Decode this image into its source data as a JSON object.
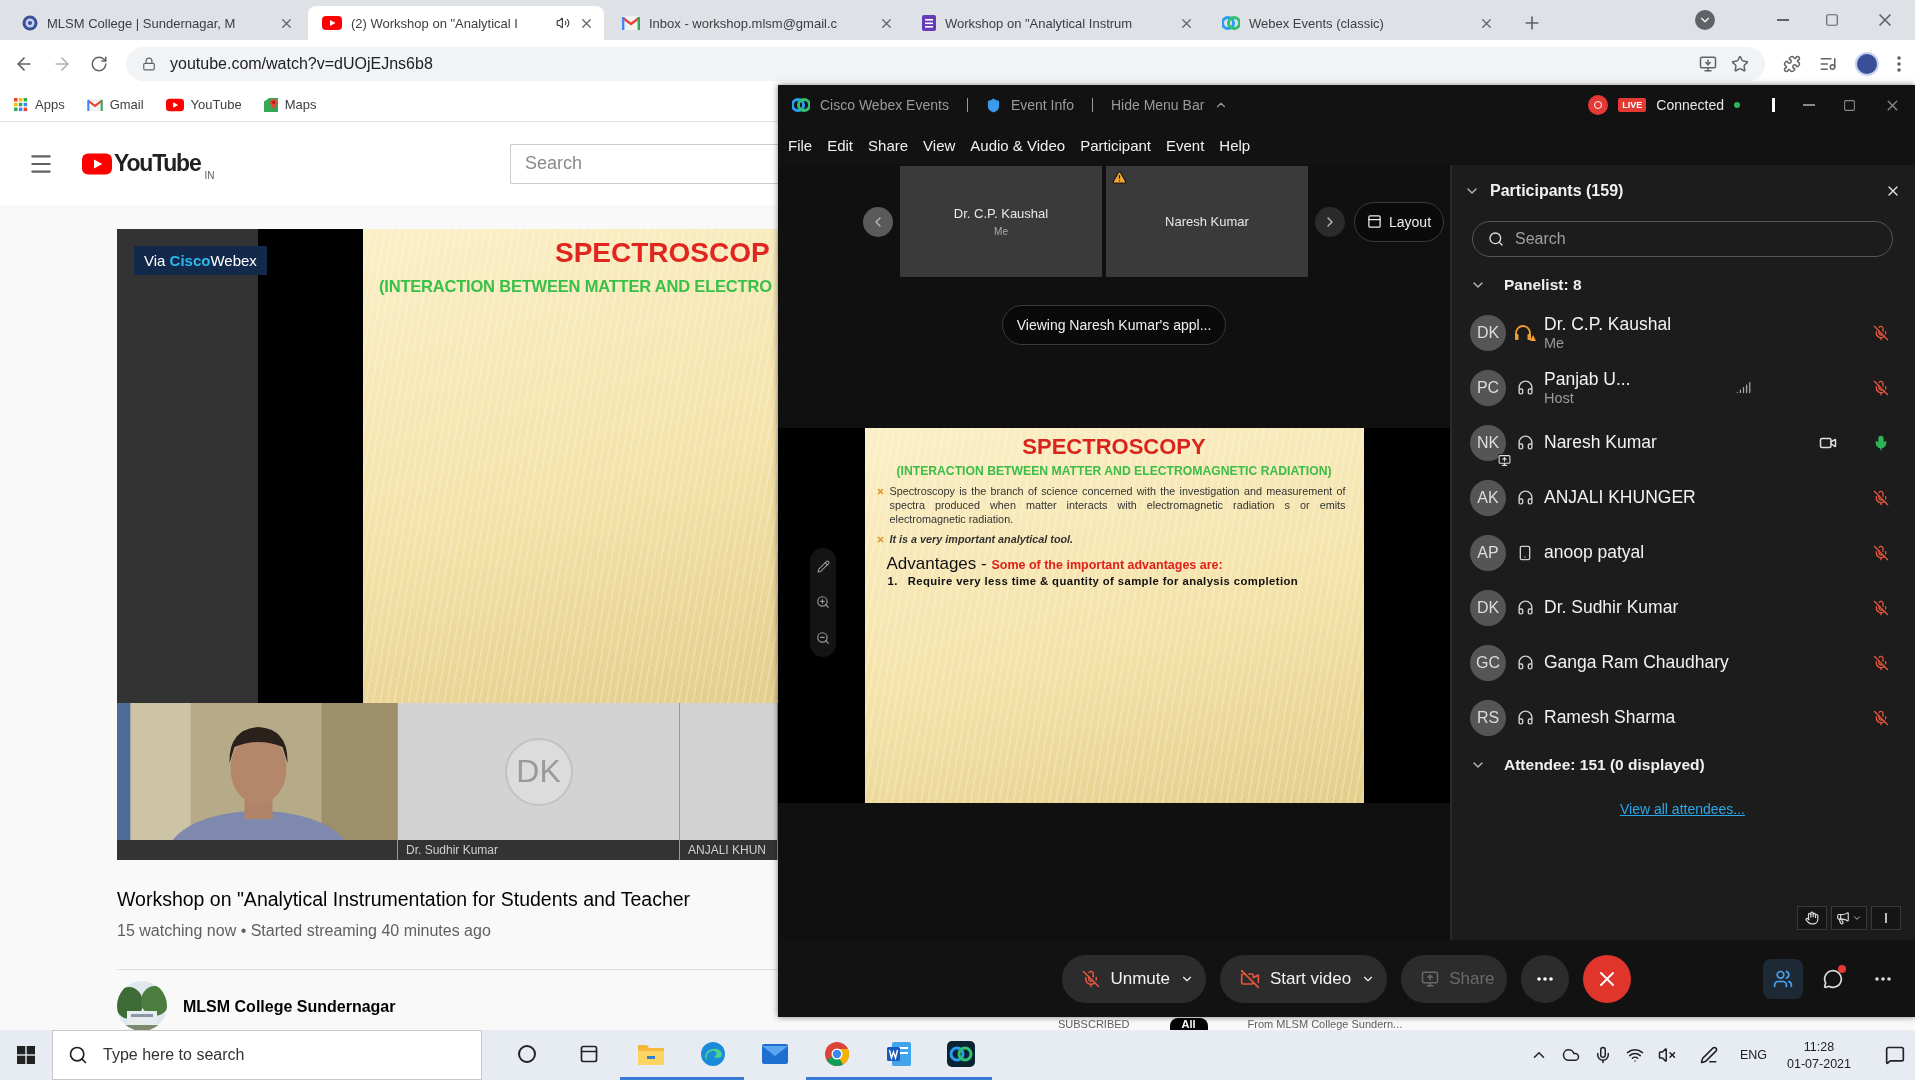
{
  "browser": {
    "tabs": [
      {
        "title": "MLSM College | Sundernagar, M",
        "kind": "college",
        "selected": false,
        "audio": false
      },
      {
        "title": "(2) Workshop on \"Analytical I",
        "kind": "youtube",
        "selected": true,
        "audio": true
      },
      {
        "title": "Inbox - workshop.mlsm@gmail.c",
        "kind": "gmail",
        "selected": false,
        "audio": false
      },
      {
        "title": "Workshop on \"Analytical Instrum",
        "kind": "forms",
        "selected": false,
        "audio": false
      },
      {
        "title": "Webex Events (classic)",
        "kind": "webex",
        "selected": false,
        "audio": false
      }
    ],
    "address": "youtube.com/watch?v=dUOjEJns6b8",
    "bookmarks": [
      {
        "label": "Apps",
        "kind": "apps"
      },
      {
        "label": "Gmail",
        "kind": "gmail"
      },
      {
        "label": "YouTube",
        "kind": "youtube"
      },
      {
        "label": "Maps",
        "kind": "maps"
      }
    ]
  },
  "youtube": {
    "logo": "YouTube",
    "region": "IN",
    "search": {
      "placeholder": "Search"
    },
    "video": {
      "badge": "Via **Cisco**Webex",
      "slide_title": "SPECTROSCOP",
      "slide_subtitle": "(INTERACTION BETWEEN MATTER AND ELECTRO",
      "tiles": [
        {
          "kind": "camera"
        },
        {
          "kind": "initials",
          "initials": "DK",
          "name": "Dr. Sudhir Kumar"
        },
        {
          "kind": "blank",
          "name": "ANJALI KHUN"
        }
      ]
    },
    "title": "Workshop on \"Analytical Instrumentation for Students and Teacher",
    "meta": "15 watching now • Started streaming 40 minutes ago",
    "channel": "MLSM College Sundernagar",
    "chat_header": [
      {
        "kind": "label",
        "text": "SUBSCRIBED"
      },
      {
        "kind": "chip",
        "text": "All"
      },
      {
        "kind": "label",
        "text": "From MLSM College Sundern..."
      }
    ]
  },
  "webex": {
    "app_title": "Cisco Webex Events",
    "event_info": "Event Info",
    "hide_menu": "Hide Menu Bar",
    "live": "LIVE",
    "status": "Connected",
    "menu": [
      "File",
      "Edit",
      "Share",
      "View",
      "Audio & Video",
      "Participant",
      "Event",
      "Help"
    ],
    "thumbnails": [
      {
        "name": "Dr. C.P. Kaushal",
        "sub": "Me",
        "warning": false
      },
      {
        "name": "Naresh Kumar",
        "warning": true
      }
    ],
    "layout": "Layout",
    "viewing": "Viewing Naresh Kumar's appl...",
    "slide": {
      "title": "SPECTROSCOPY",
      "subtitle": "(INTERACTION BETWEEN MATTER AND ELECTROMAGNETIC RADIATION)",
      "bullets": [
        {
          "text": "Spectroscopy is the branch of science concerned with the investigation and measurement of spectra produced when matter interacts with electromagnetic radiation s or emits electromagnetic radiation.",
          "emphasis": false
        },
        {
          "text": "It is a very important analytical tool.",
          "emphasis": true
        }
      ],
      "heading": "Advantages - **Some of the important advantages are:**",
      "points": [
        {
          "number": "1.",
          "text": "Require very less time & quantity of sample for analysis completion"
        }
      ]
    },
    "participants": {
      "title": "Participants (159)",
      "search": {
        "placeholder": "Search"
      },
      "sections": [
        {
          "heading": "Panelist: 8",
          "expanded": true,
          "people": [
            {
              "initials": "DK",
              "name": "Dr. C.P. Kaushal",
              "sub": "Me",
              "kind": "headset_warning",
              "muted": true,
              "sharing": false
            },
            {
              "initials": "PC",
              "name": "Panjab U...",
              "sub": "Host",
              "kind": "headset",
              "indicator": {
                "kind": "bars"
              },
              "muted": true,
              "sharing": false
            },
            {
              "initials": "NK",
              "name": "Naresh Kumar",
              "kind": "headset",
              "indicator": {
                "kind": "video"
              },
              "muted": false,
              "sharing": true
            },
            {
              "initials": "AK",
              "name": "ANJALI KHUNGER",
              "kind": "headset",
              "muted": true,
              "sharing": false
            },
            {
              "initials": "AP",
              "name": "anoop patyal",
              "kind": "phone",
              "muted": true,
              "sharing": false
            },
            {
              "initials": "DK",
              "name": "Dr. Sudhir Kumar",
              "kind": "headset",
              "muted": true,
              "sharing": false
            },
            {
              "initials": "GC",
              "name": "Ganga Ram Chaudhary",
              "kind": "headset",
              "muted": true,
              "sharing": false
            },
            {
              "initials": "RS",
              "name": "Ramesh Sharma",
              "kind": "headset",
              "muted": true,
              "sharing": false
            }
          ]
        },
        {
          "heading": "Attendee: 151 (0 displayed)",
          "expanded": true,
          "link": "View all attendees..."
        }
      ]
    },
    "controls": {
      "unmute": "Unmute",
      "video": "Start video",
      "share": {
        "label": "Share",
        "disabled": true
      },
      "participants_open": true,
      "chat_unread": true
    }
  },
  "taskbar": {
    "search": {
      "placeholder": "Type here to search"
    },
    "apps": [
      {
        "kind": "explorer",
        "running": true
      },
      {
        "kind": "edge",
        "running": true
      },
      {
        "kind": "mail",
        "running": false
      },
      {
        "kind": "chrome",
        "running": true
      },
      {
        "kind": "word",
        "running": true
      },
      {
        "kind": "webex",
        "running": true
      }
    ],
    "language": "ENG",
    "time": "11:28",
    "date": "01-07-2021"
  }
}
